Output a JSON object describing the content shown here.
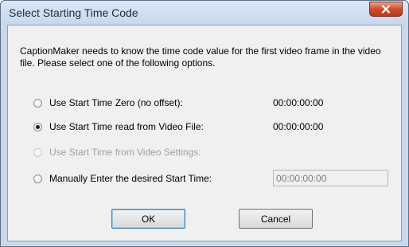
{
  "window": {
    "title": "Select Starting Time Code"
  },
  "description": "CaptionMaker needs to know the time code value for the first video frame in the video file. Please select one of the following options.",
  "options": [
    {
      "label": "Use Start Time Zero (no offset):",
      "value": "00:00:00:00",
      "selected": false,
      "enabled": true
    },
    {
      "label": "Use Start Time read from Video File:",
      "value": "00:00:00:00",
      "selected": true,
      "enabled": true
    },
    {
      "label": "Use Start Time from Video Settings:",
      "value": "",
      "selected": false,
      "enabled": false
    },
    {
      "label": "Manually Enter the desired Start Time:",
      "value": "00:00:00:00",
      "selected": false,
      "enabled": true
    }
  ],
  "buttons": {
    "ok": "OK",
    "cancel": "Cancel"
  },
  "icons": {
    "close": "close-icon"
  },
  "colors": {
    "close_button": "#c2371a",
    "titlebar": "#c9d8eb",
    "dialog_bg": "#f0f0f0",
    "disabled_text": "#a0a0a0"
  }
}
